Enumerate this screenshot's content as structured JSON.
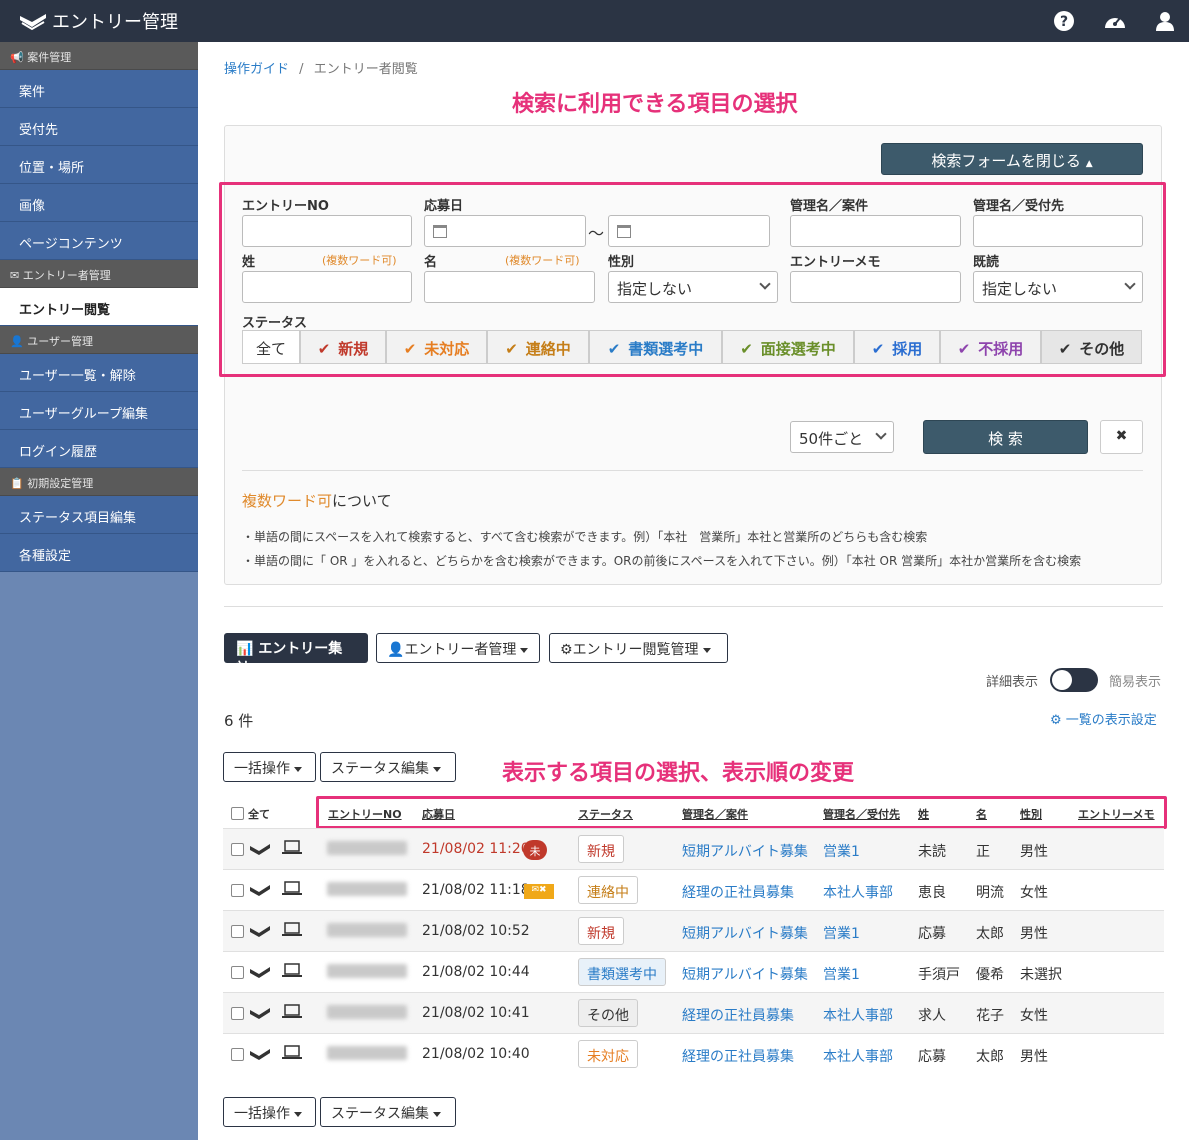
{
  "app": {
    "title": "エントリー管理"
  },
  "sidebar": {
    "groups": [
      {
        "label": "案件管理",
        "items": [
          "案件",
          "受付先",
          "位置・場所",
          "画像",
          "ページコンテンツ"
        ]
      },
      {
        "label": "エントリー者管理",
        "items": [
          "エントリー閲覧"
        ]
      },
      {
        "label": "ユーザー管理",
        "items": [
          "ユーザー一覧・解除",
          "ユーザーグループ編集",
          "ログイン履歴"
        ]
      },
      {
        "label": "初期設定管理",
        "items": [
          "ステータス項目編集",
          "各種設定"
        ]
      }
    ]
  },
  "breadcrumb": {
    "guide": "操作ガイド",
    "sep": "/",
    "current": "エントリー者閲覧"
  },
  "annotations": {
    "search": "検索に利用できる項目の選択",
    "display": "表示する項目の選択、表示順の変更"
  },
  "search_form": {
    "close_button": "検索フォームを閉じる",
    "labels": {
      "entry_no": "エントリーNO",
      "apply_date": "応募日",
      "tilde": "〜",
      "kanri_anken": "管理名／案件",
      "kanri_uketsuke": "管理名／受付先",
      "sei": "姓",
      "mei": "名",
      "multi_note": "(複数ワード可)",
      "gender": "性別",
      "memo": "エントリーメモ",
      "read": "既読",
      "status": "ステータス"
    },
    "gender_value": "指定しない",
    "read_value": "指定しない",
    "statuses": [
      {
        "label": "全て",
        "checked": false,
        "color": "#333333"
      },
      {
        "label": "新規",
        "checked": true,
        "color": "#c0392b"
      },
      {
        "label": "未対応",
        "checked": true,
        "color": "#e67e22"
      },
      {
        "label": "連絡中",
        "checked": true,
        "color": "#c57e18"
      },
      {
        "label": "書類選考中",
        "checked": true,
        "color": "#2a7cc7"
      },
      {
        "label": "面接選考中",
        "checked": true,
        "color": "#6a8f2a"
      },
      {
        "label": "採用",
        "checked": true,
        "color": "#2b6ed1"
      },
      {
        "label": "不採用",
        "checked": true,
        "color": "#8e44ad"
      },
      {
        "label": "その他",
        "checked": true,
        "color": "#333333"
      }
    ],
    "per_page": "50件ごと",
    "search_button": "検 索",
    "clear_button": "✖",
    "note_title_highlight": "複数ワード可",
    "note_title_rest": "について",
    "note_line1": "・単語の間にスペースを入れて検索すると、すべて含む検索ができます。例）「本社　営業所」本社と営業所のどちらも含む検索",
    "note_line2": "・単語の間に「 OR 」を入れると、どちらかを含む検索ができます。ORの前後にスペースを入れて下さい。例）「本社 OR 営業所」本社か営業所を含む検索"
  },
  "toolbar": {
    "entry_stats": "エントリー集計",
    "entry_manage": "エントリー者管理",
    "view_manage": "エントリー閲覧管理",
    "detail": "詳細表示",
    "simple": "簡易表示",
    "count": "6 件",
    "list_settings": "一覧の表示設定",
    "bulk": "一括操作",
    "status_edit": "ステータス編集"
  },
  "table": {
    "headers": {
      "all": "全て",
      "entry_no": "エントリーNO",
      "date": "応募日",
      "status": "ステータス",
      "anken": "管理名／案件",
      "uketsuke": "管理名／受付先",
      "sei": "姓",
      "mei": "名",
      "gender": "性別",
      "memo": "エントリーメモ"
    },
    "rows": [
      {
        "date": "21/08/02 11:20",
        "unread": "未",
        "mail": "",
        "status": "新規",
        "status_color": "#c0392b",
        "status_bg": "#fff",
        "anken": "短期アルバイト募集",
        "uketsuke": "営業1",
        "sei": "未読",
        "mei": "正",
        "gender": "男性"
      },
      {
        "date": "21/08/02 11:18",
        "unread": "",
        "mail": "✉✖",
        "status": "連絡中",
        "status_color": "#c57e18",
        "status_bg": "#fff",
        "anken": "経理の正社員募集",
        "uketsuke": "本社人事部",
        "sei": "恵良",
        "mei": "明流",
        "gender": "女性"
      },
      {
        "date": "21/08/02 10:52",
        "unread": "",
        "mail": "",
        "status": "新規",
        "status_color": "#c0392b",
        "status_bg": "#fff",
        "anken": "短期アルバイト募集",
        "uketsuke": "営業1",
        "sei": "応募",
        "mei": "太郎",
        "gender": "男性"
      },
      {
        "date": "21/08/02 10:44",
        "unread": "",
        "mail": "",
        "status": "書類選考中",
        "status_color": "#2a7cc7",
        "status_bg": "#e8f1f9",
        "anken": "短期アルバイト募集",
        "uketsuke": "営業1",
        "sei": "手須戸",
        "mei": "優希",
        "gender": "未選択"
      },
      {
        "date": "21/08/02 10:41",
        "unread": "",
        "mail": "",
        "status": "その他",
        "status_color": "#333333",
        "status_bg": "#eeeeee",
        "anken": "経理の正社員募集",
        "uketsuke": "本社人事部",
        "sei": "求人",
        "mei": "花子",
        "gender": "女性"
      },
      {
        "date": "21/08/02 10:40",
        "unread": "",
        "mail": "",
        "status": "未対応",
        "status_color": "#e67e22",
        "status_bg": "#fff",
        "anken": "経理の正社員募集",
        "uketsuke": "本社人事部",
        "sei": "応募",
        "mei": "太郎",
        "gender": "男性"
      }
    ]
  }
}
